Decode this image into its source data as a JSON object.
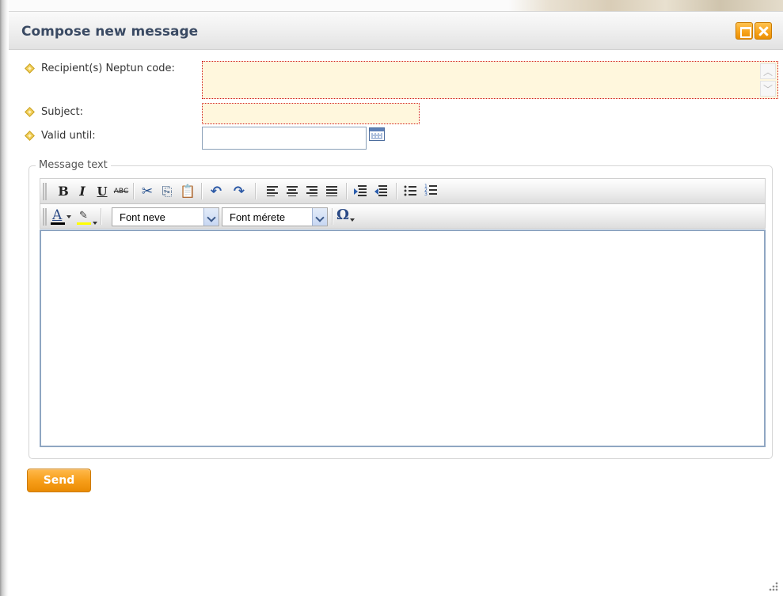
{
  "dialog": {
    "title": "Compose new message",
    "icons": {
      "maximize": "maximize-icon",
      "close": "close-icon"
    }
  },
  "form": {
    "recipient_label": "Recipient(s) Neptun code:",
    "recipient_value": "",
    "subject_label": "Subject:",
    "subject_value": "",
    "valid_until_label": "Valid until:",
    "valid_until_value": "",
    "calendar_icon": "calendar-icon",
    "required_field_color": "#d11a1a",
    "required_field_bg": "#fff7dd"
  },
  "editor": {
    "legend": "Message text",
    "toolbar1": {
      "bold": "B",
      "italic": "I",
      "underline": "U",
      "strikethrough": "ABC",
      "cut": "✂",
      "copy": "⎘",
      "paste": "📋",
      "undo": "↶",
      "redo": "↷"
    },
    "toolbar2": {
      "font_color_glyph": "A",
      "highlight_glyph": "✎",
      "font_name_value": "Font neve",
      "font_size_value": "Font mérete",
      "special_char_glyph": "Ω"
    },
    "content": ""
  },
  "actions": {
    "send_label": "Send",
    "accent_color": "#f79f1b"
  }
}
